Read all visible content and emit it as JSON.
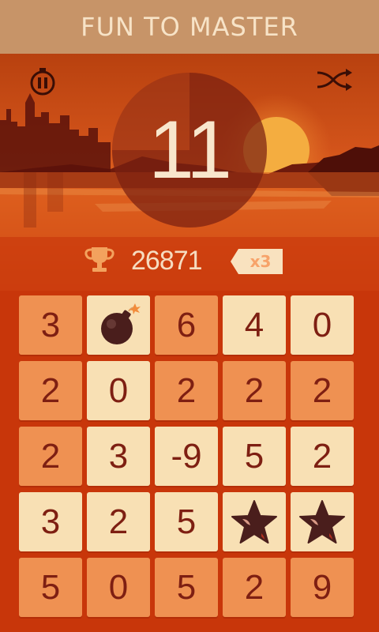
{
  "banner": {
    "title": "FUN TO MASTER"
  },
  "hud": {
    "pause_icon": "pause-icon",
    "shuffle_icon": "shuffle-icon",
    "timer_value": "11",
    "score": "26871",
    "multiplier": "x3"
  },
  "colors": {
    "background": "#c8360a",
    "banner": "#c79468",
    "tile_dark": "#ef9152",
    "tile_light": "#f8e0b4",
    "tile_text": "#7e1f12"
  },
  "grid": {
    "rows": [
      [
        {
          "type": "number",
          "value": "3",
          "shade": "dark"
        },
        {
          "type": "bomb",
          "value": "",
          "shade": "light"
        },
        {
          "type": "number",
          "value": "6",
          "shade": "dark"
        },
        {
          "type": "number",
          "value": "4",
          "shade": "light"
        },
        {
          "type": "number",
          "value": "0",
          "shade": "light"
        }
      ],
      [
        {
          "type": "number",
          "value": "2",
          "shade": "dark"
        },
        {
          "type": "number",
          "value": "0",
          "shade": "light"
        },
        {
          "type": "number",
          "value": "2",
          "shade": "dark"
        },
        {
          "type": "number",
          "value": "2",
          "shade": "dark"
        },
        {
          "type": "number",
          "value": "2",
          "shade": "dark"
        }
      ],
      [
        {
          "type": "number",
          "value": "2",
          "shade": "dark"
        },
        {
          "type": "number",
          "value": "3",
          "shade": "light"
        },
        {
          "type": "number",
          "value": "-9",
          "shade": "light"
        },
        {
          "type": "number",
          "value": "5",
          "shade": "light"
        },
        {
          "type": "number",
          "value": "2",
          "shade": "light"
        }
      ],
      [
        {
          "type": "number",
          "value": "3",
          "shade": "light"
        },
        {
          "type": "number",
          "value": "2",
          "shade": "light"
        },
        {
          "type": "number",
          "value": "5",
          "shade": "light"
        },
        {
          "type": "star",
          "value": "",
          "shade": "light"
        },
        {
          "type": "star",
          "value": "",
          "shade": "light"
        }
      ],
      [
        {
          "type": "number",
          "value": "5",
          "shade": "dark"
        },
        {
          "type": "number",
          "value": "0",
          "shade": "dark"
        },
        {
          "type": "number",
          "value": "5",
          "shade": "dark"
        },
        {
          "type": "number",
          "value": "2",
          "shade": "dark"
        },
        {
          "type": "number",
          "value": "9",
          "shade": "dark"
        }
      ]
    ]
  }
}
